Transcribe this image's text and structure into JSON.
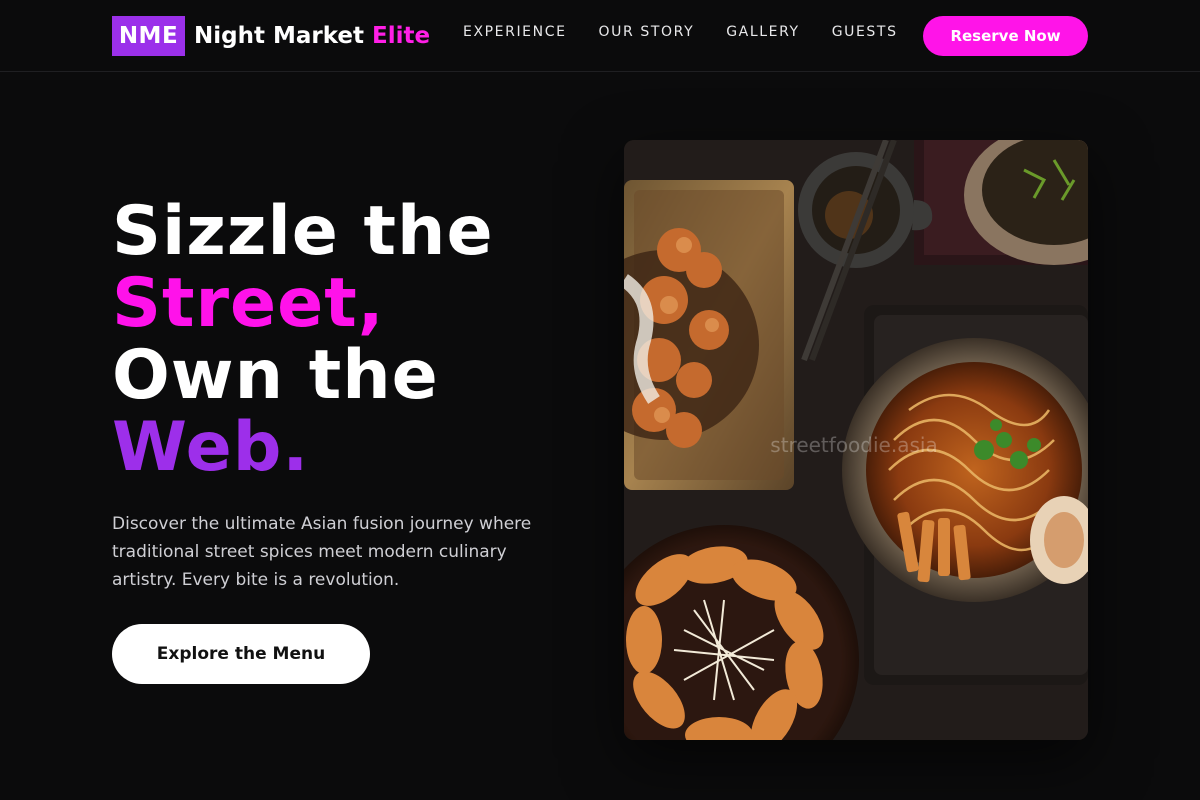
{
  "brand": {
    "badge": "NME",
    "name": "Night Market",
    "accent": "Elite"
  },
  "nav": {
    "links": [
      "EXPERIENCE",
      "OUR STORY",
      "GALLERY",
      "GUESTS"
    ],
    "cta": "Reserve Now"
  },
  "hero": {
    "title_lines": [
      "Sizzle the",
      "Street,",
      "Own the",
      "Web."
    ],
    "description": "Discover the ultimate Asian fusion journey where traditional street spices meet modern culinary artistry. Every bite is a revolution.",
    "cta": "Explore the Menu",
    "image_watermark": "streetfoodie.asia"
  },
  "colors": {
    "background": "#0b0b0c",
    "brand_purple": "#9b30ea",
    "accent_pink": "#ff14e8",
    "text_purple": "#9d2fea"
  }
}
